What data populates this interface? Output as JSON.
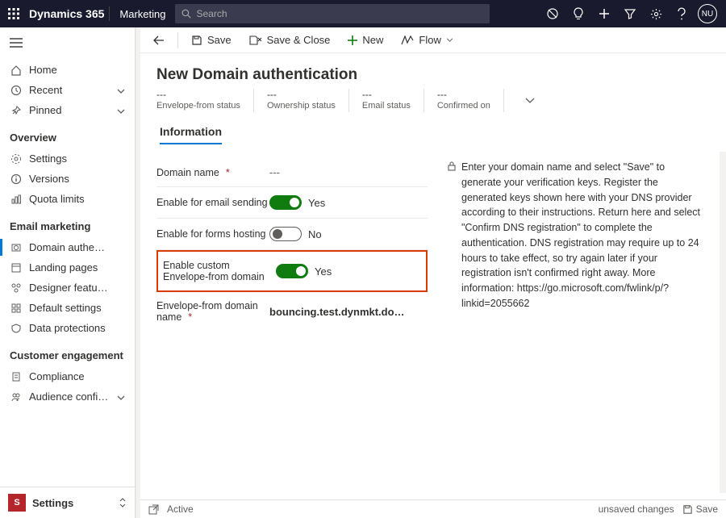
{
  "header": {
    "brand": "Dynamics 365",
    "module": "Marketing",
    "search_placeholder": "Search",
    "avatar_initials": "NU"
  },
  "nav": {
    "items_top": [
      {
        "icon": "home",
        "label": "Home"
      },
      {
        "icon": "clock",
        "label": "Recent",
        "chevron": true
      },
      {
        "icon": "pin",
        "label": "Pinned",
        "chevron": true
      }
    ],
    "sections": [
      {
        "heading": "Overview",
        "items": [
          {
            "icon": "gear",
            "label": "Settings"
          },
          {
            "icon": "info",
            "label": "Versions"
          },
          {
            "icon": "quota",
            "label": "Quota limits"
          }
        ]
      },
      {
        "heading": "Email marketing",
        "items": [
          {
            "icon": "domain",
            "label": "Domain authentic…",
            "selected": true
          },
          {
            "icon": "landing",
            "label": "Landing pages"
          },
          {
            "icon": "designer",
            "label": "Designer feature …"
          },
          {
            "icon": "defaults",
            "label": "Default settings"
          },
          {
            "icon": "shield",
            "label": "Data protections"
          }
        ]
      },
      {
        "heading": "Customer engagement",
        "items": [
          {
            "icon": "compliance",
            "label": "Compliance"
          },
          {
            "icon": "audience",
            "label": "Audience configur…"
          }
        ]
      }
    ],
    "area": {
      "tile": "S",
      "label": "Settings"
    }
  },
  "commandbar": {
    "save": "Save",
    "save_close": "Save & Close",
    "new": "New",
    "flow": "Flow"
  },
  "page": {
    "title": "New Domain authentication",
    "status": [
      {
        "value": "---",
        "label": "Envelope-from status"
      },
      {
        "value": "---",
        "label": "Ownership status"
      },
      {
        "value": "---",
        "label": "Email status"
      },
      {
        "value": "---",
        "label": "Confirmed on"
      }
    ],
    "tab": "Information",
    "form": {
      "domain_name_label": "Domain name",
      "domain_name_value": "---",
      "email_sending_label": "Enable for email sending",
      "email_sending_val": "Yes",
      "forms_hosting_label": "Enable for forms hosting",
      "forms_hosting_val": "No",
      "envelope_enable_label": "Enable custom Envelope-from domain",
      "envelope_enable_val": "Yes",
      "envelope_domain_label": "Envelope-from domain name",
      "envelope_domain_value": "bouncing.test.dynmkt.do…"
    },
    "info_text": "Enter your domain name and select \"Save\" to generate your verification keys. Register the generated keys shown here with your DNS provider according to their instructions. Return here and select \"Confirm DNS registration\" to complete the authentication. DNS registration may require up to 24 hours to take effect, so try again later if your registration isn't confirmed right away. More information: https://go.microsoft.com/fwlink/p/?linkid=2055662"
  },
  "footer": {
    "state": "Active",
    "unsaved": "unsaved changes",
    "save": "Save"
  }
}
